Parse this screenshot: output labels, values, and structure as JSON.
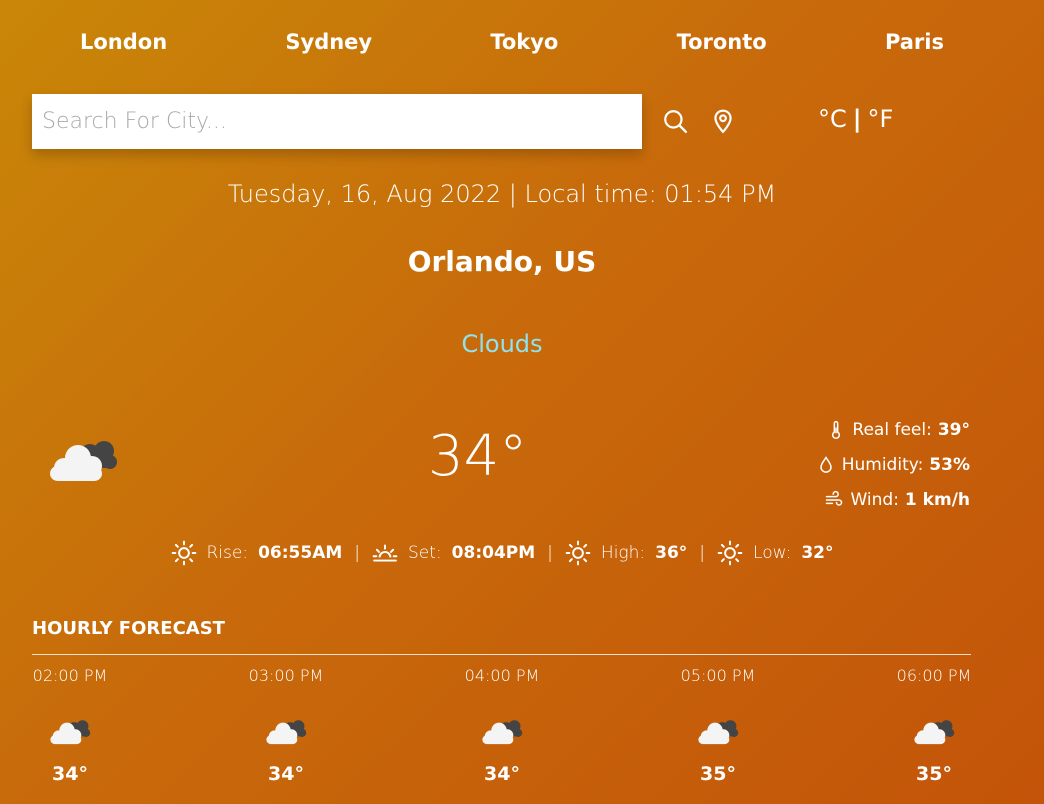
{
  "cities": [
    "London",
    "Sydney",
    "Tokyo",
    "Toronto",
    "Paris"
  ],
  "search": {
    "placeholder": "Search For City..."
  },
  "icons": {
    "search": "search-icon",
    "location": "location-pin-icon",
    "cloud": "cloud-icon",
    "thermometer": "thermometer-icon",
    "humidity": "droplet-icon",
    "wind": "wind-icon",
    "sun": "sun-icon",
    "sunset": "sunset-icon"
  },
  "units": {
    "celsius": "°C",
    "separator": "|",
    "fahrenheit": "°F"
  },
  "datetime": "Tuesday, 16, Aug 2022 | Local time: 01:54 PM",
  "location": "Orlando, US",
  "condition": "Clouds",
  "colors": {
    "condition": "#8fe3ec",
    "background_start": "#c98708",
    "background_end": "#c35409"
  },
  "temperature": "34°",
  "details": {
    "real_feel_label": "Real feel:",
    "real_feel_value": "39°",
    "humidity_label": "Humidity:",
    "humidity_value": "53%",
    "wind_label": "Wind:",
    "wind_value": "1 km/h"
  },
  "sun": {
    "rise_label": "Rise:",
    "rise_value": "06:55AM",
    "set_label": "Set:",
    "set_value": "08:04PM",
    "high_label": "High:",
    "high_value": "36°",
    "low_label": "Low:",
    "low_value": "32°",
    "separator": "|"
  },
  "hourly": {
    "title": "HOURLY FORECAST",
    "items": [
      {
        "time": "02:00 PM",
        "temp": "34°"
      },
      {
        "time": "03:00 PM",
        "temp": "34°"
      },
      {
        "time": "04:00 PM",
        "temp": "34°"
      },
      {
        "time": "05:00 PM",
        "temp": "35°"
      },
      {
        "time": "06:00 PM",
        "temp": "35°"
      }
    ]
  }
}
